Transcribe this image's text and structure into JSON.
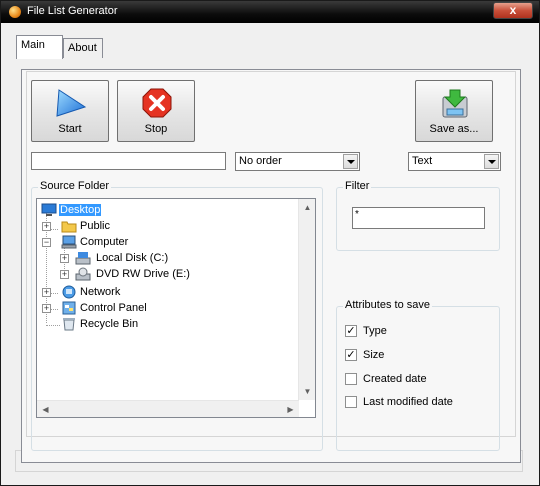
{
  "window": {
    "title": "File List Generator",
    "close_label": "x"
  },
  "tabs": [
    {
      "label": "Main"
    },
    {
      "label": "About"
    }
  ],
  "toolbar": {
    "start_label": "Start",
    "stop_label": "Stop",
    "save_as_label": "Save as...",
    "start_icon": "play-triangle-icon",
    "stop_icon": "stop-x-icon",
    "save_icon": "save-disk-icon"
  },
  "path_input": {
    "value": ""
  },
  "order_select": {
    "selected": "No order"
  },
  "format_select": {
    "selected": "Text"
  },
  "source_folder": {
    "title": "Source Folder",
    "tree": [
      {
        "label": "Desktop",
        "icon": "desktop-icon",
        "selected": true
      },
      {
        "label": "Public",
        "icon": "folder-icon"
      },
      {
        "label": "Computer",
        "icon": "computer-icon"
      },
      {
        "label": "Local Disk (C:)",
        "icon": "hard-disk-icon"
      },
      {
        "label": "DVD RW Drive (E:)",
        "icon": "dvd-drive-icon"
      },
      {
        "label": "Network",
        "icon": "network-icon"
      },
      {
        "label": "Control Panel",
        "icon": "control-panel-icon"
      },
      {
        "label": "Recycle Bin",
        "icon": "recycle-bin-icon"
      }
    ]
  },
  "filter": {
    "title": "Filter",
    "value": "*"
  },
  "attributes": {
    "title": "Attributes to save",
    "items": [
      {
        "label": "Type",
        "checked": true
      },
      {
        "label": "Size",
        "checked": true
      },
      {
        "label": "Created date",
        "checked": false
      },
      {
        "label": "Last modified date",
        "checked": false
      }
    ]
  },
  "status": {
    "text": ""
  },
  "colors": {
    "selection": "#3399ff",
    "titlebar": "#000000",
    "close": "#c9503a"
  }
}
